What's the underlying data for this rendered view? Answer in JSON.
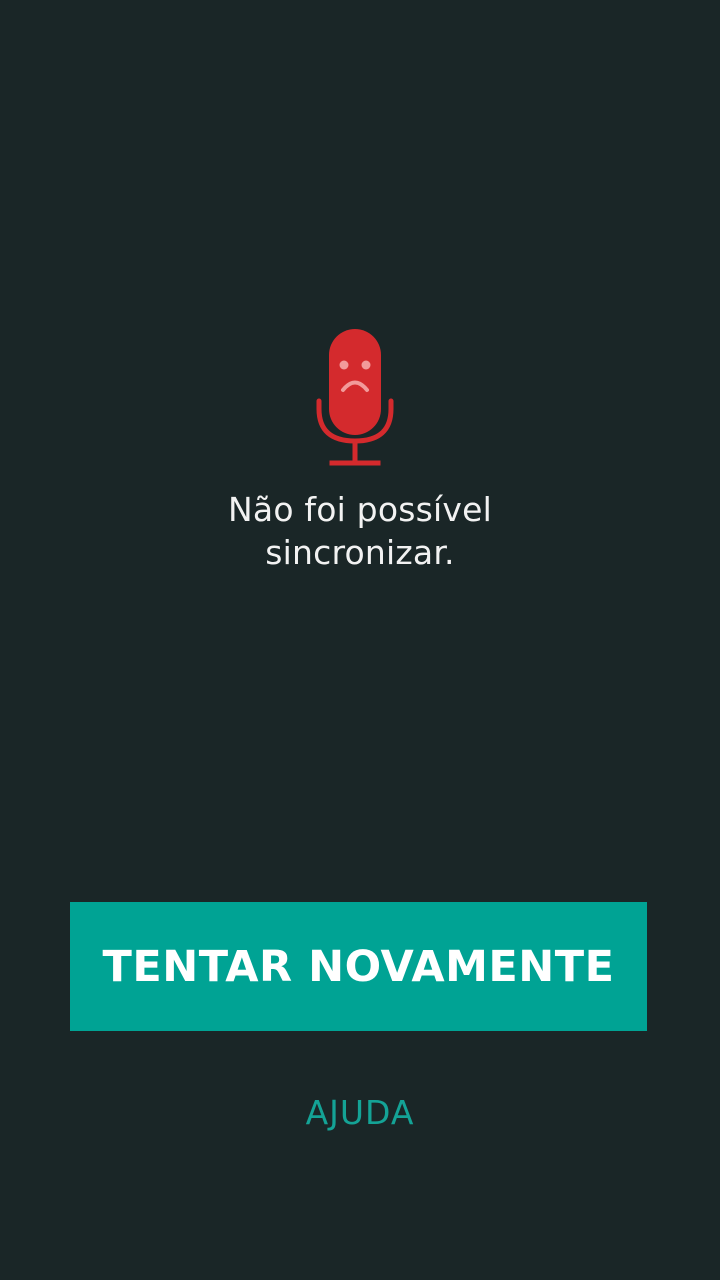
{
  "sync_error": {
    "icon": "sad-microphone-icon",
    "message_line1": "Não foi possível",
    "message_line2": "sincronizar.",
    "retry_label": "TENTAR NOVAMENTE",
    "help_label": "AJUDA"
  },
  "colors": {
    "background": "#1a2627",
    "icon_red": "#d42a2d",
    "icon_face": "#f29a9a",
    "button_bg": "#00a394",
    "button_text": "#ffffff",
    "message_text": "#f2f2f2",
    "help_text": "#14a396"
  }
}
